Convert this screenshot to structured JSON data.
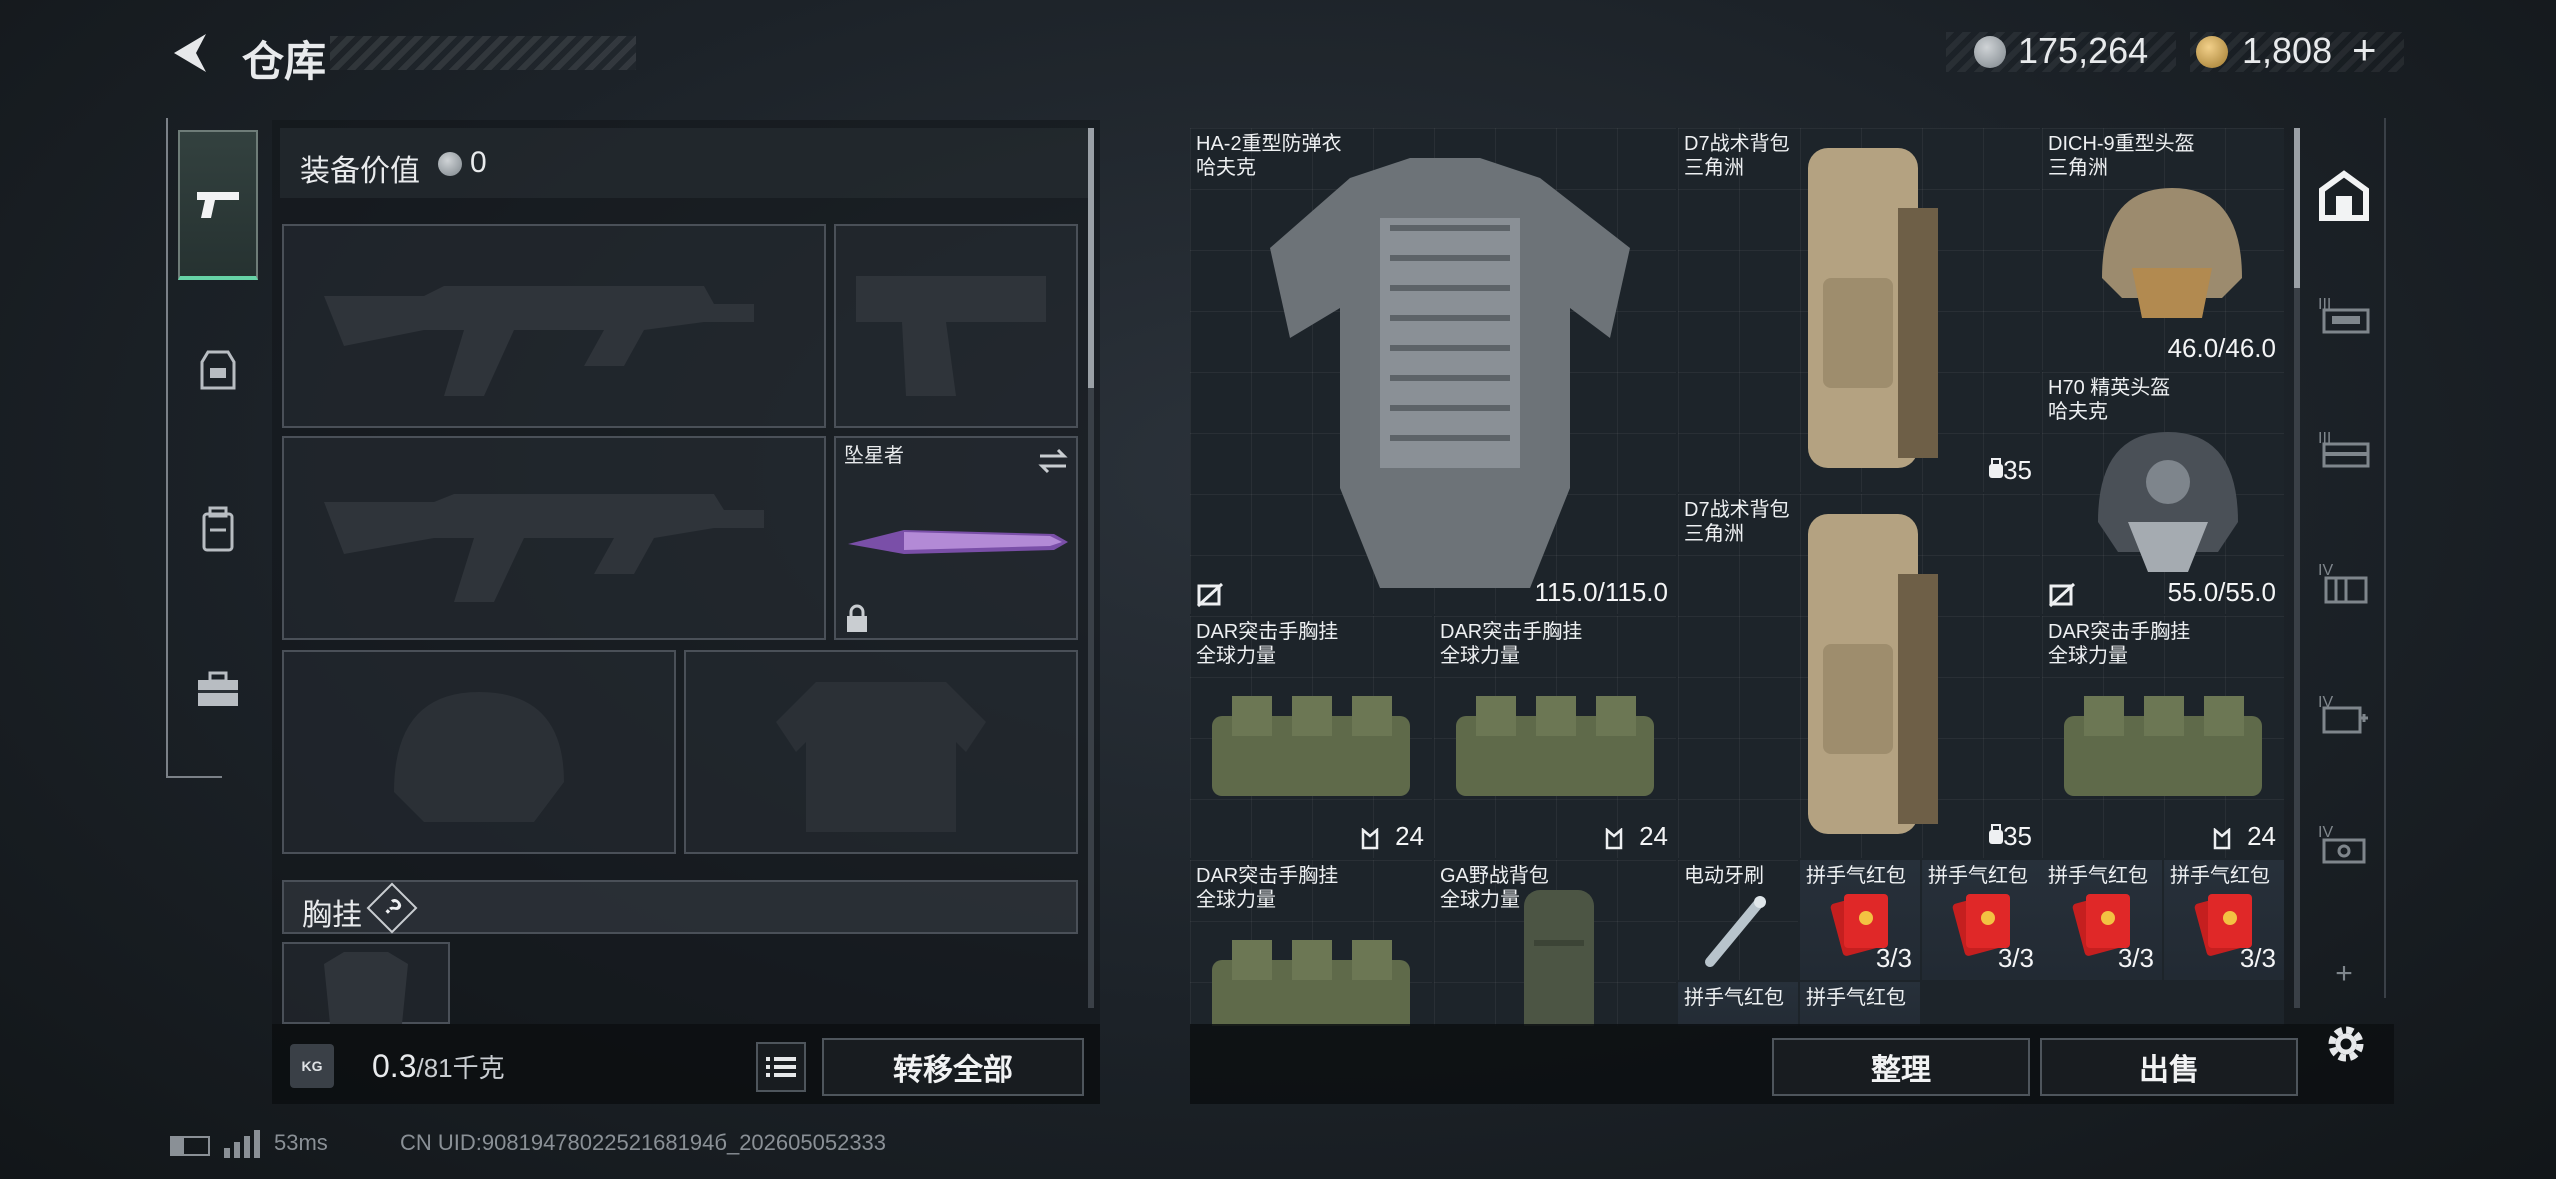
{
  "header": {
    "title": "仓库",
    "currency_silver": "175,264",
    "currency_gold": "1,808",
    "add_symbol": "+"
  },
  "loadout": {
    "equip_value_label": "装备价值",
    "equip_value": "0",
    "melee_name": "坠星者",
    "chest_rig_label": "胸挂",
    "help_symbol": "?",
    "weight_current": "0.3",
    "weight_max": "/81千克",
    "weight_icon_text": "KG",
    "transfer_all": "转移全部"
  },
  "items": [
    {
      "name": "HA-2重型防弹衣",
      "sub": "哈夫克",
      "value": "115.0/115.0"
    },
    {
      "name": "D7战术背包",
      "sub": "三角洲",
      "value": "35"
    },
    {
      "name": "DICH-9重型头盔",
      "sub": "三角洲",
      "value": "46.0/46.0"
    },
    {
      "name": "H70 精英头盔",
      "sub": "哈夫克",
      "value": "55.0/55.0"
    },
    {
      "name": "D7战术背包",
      "sub": "三角洲",
      "value": "35"
    },
    {
      "name": "DAR突击手胸挂",
      "sub": "全球力量",
      "value": "24"
    },
    {
      "name": "DAR突击手胸挂",
      "sub": "全球力量",
      "value": "24"
    },
    {
      "name": "DAR突击手胸挂",
      "sub": "全球力量",
      "value": "24"
    },
    {
      "name": "DAR突击手胸挂",
      "sub": "全球力量",
      "value": ""
    },
    {
      "name": "GA野战背包",
      "sub": "全球力量",
      "value": ""
    },
    {
      "name": "电动牙刷",
      "sub": "",
      "value": ""
    },
    {
      "name": "拼手气红包",
      "sub": "",
      "value": "3/3"
    },
    {
      "name": "拼手气红包",
      "sub": "",
      "value": "3/3"
    },
    {
      "name": "拼手气红包",
      "sub": "",
      "value": "3/3"
    },
    {
      "name": "拼手气红包",
      "sub": "",
      "value": "3/3"
    },
    {
      "name": "拼手气红包",
      "sub": "",
      "value": ""
    },
    {
      "name": "拼手气红包",
      "sub": "",
      "value": ""
    }
  ],
  "actions": {
    "sort": "整理",
    "sell": "出售"
  },
  "sidebar": {
    "tiers": [
      "III",
      "III",
      "IV",
      "IV",
      "IV"
    ],
    "more_symbol": "+"
  },
  "status": {
    "ping": "53ms",
    "uid": "CN UID:9081947802252168194б_202605052333"
  },
  "colors": {
    "active_tab_accent": "#66d2a6",
    "rare_red": "#5a2329",
    "uncommon_brown": "#3c3129",
    "common_blue": "#27303a"
  }
}
